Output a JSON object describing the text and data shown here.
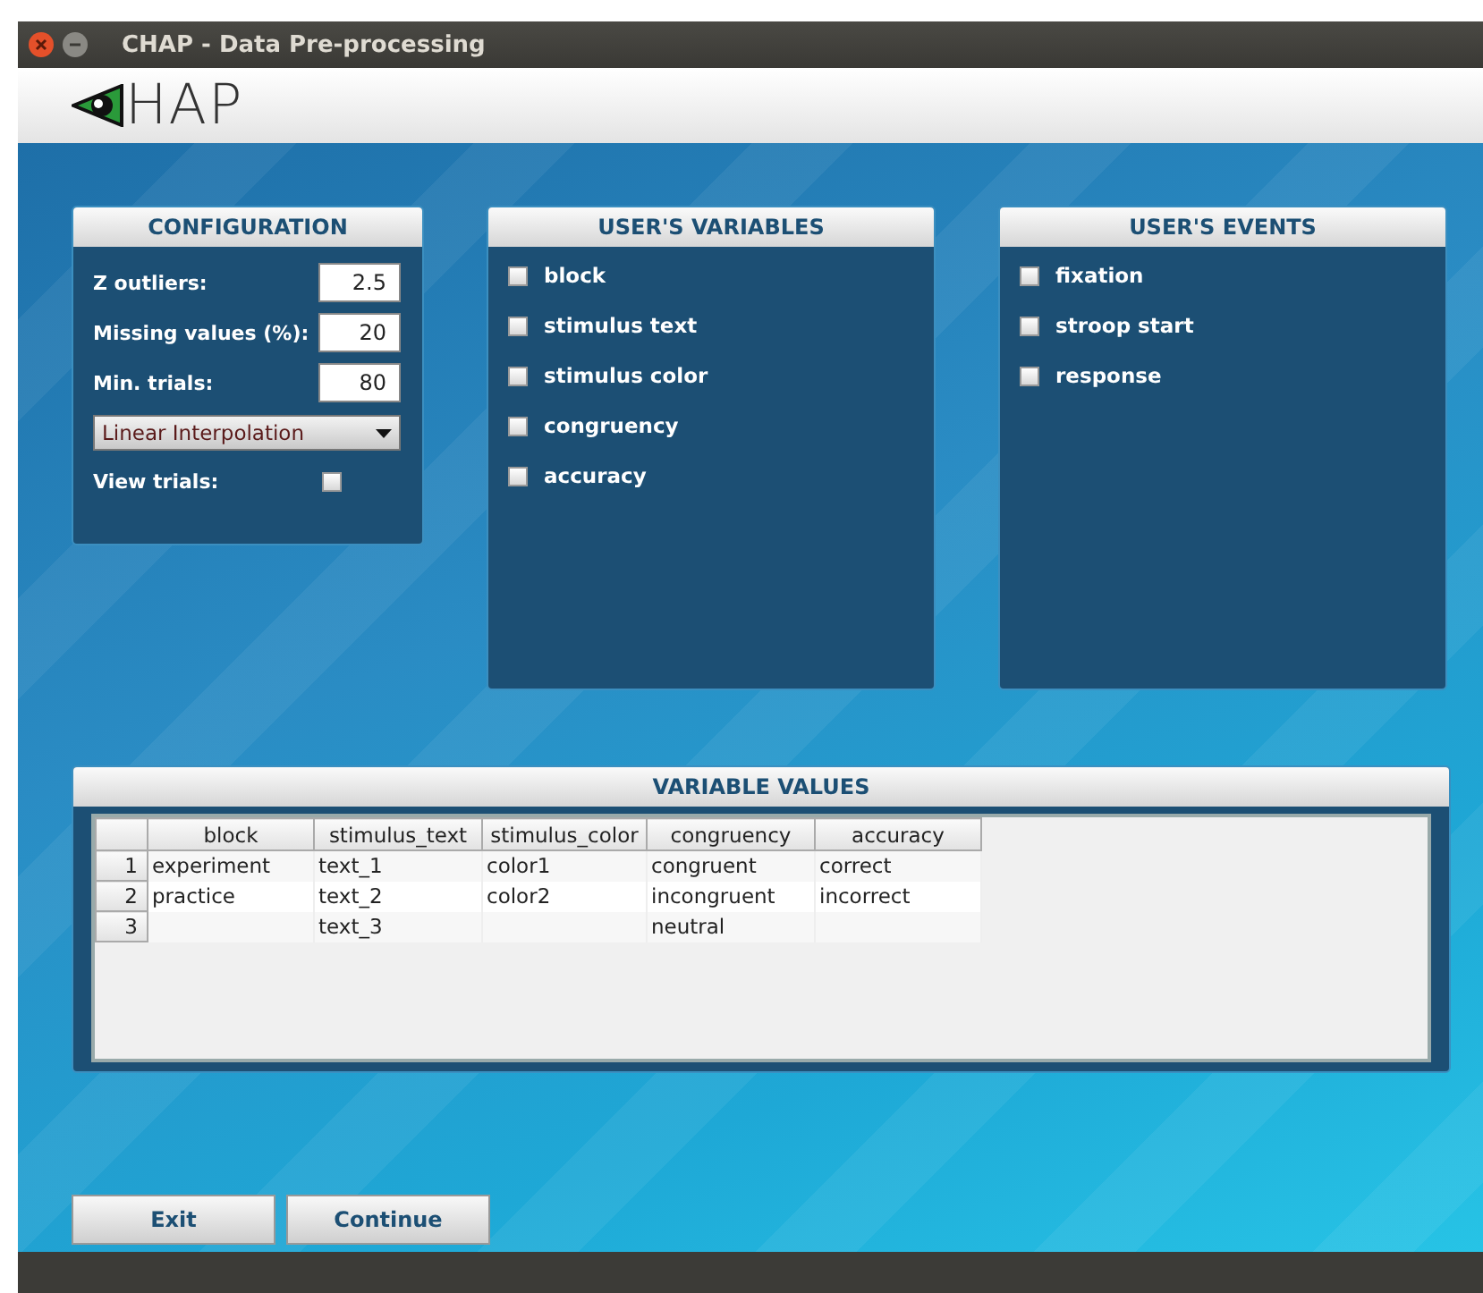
{
  "window": {
    "title": "CHAP - Data Pre-processing"
  },
  "logo": {
    "text": "HAP"
  },
  "configuration": {
    "title": "CONFIGURATION",
    "fields": [
      {
        "label": "Z outliers:",
        "value": "2.5"
      },
      {
        "label": "Missing values (%):",
        "value": "20"
      },
      {
        "label": "Min. trials:",
        "value": "80"
      }
    ],
    "method": {
      "value": "Linear Interpolation"
    },
    "view_trials": {
      "label": "View trials:",
      "checked": false
    }
  },
  "variables": {
    "title": "USER'S VARIABLES",
    "items": [
      {
        "label": "block",
        "checked": false
      },
      {
        "label": "stimulus text",
        "checked": false
      },
      {
        "label": "stimulus color",
        "checked": false
      },
      {
        "label": "congruency",
        "checked": false
      },
      {
        "label": "accuracy",
        "checked": false
      }
    ]
  },
  "events": {
    "title": "USER'S EVENTS",
    "items": [
      {
        "label": "fixation",
        "checked": false
      },
      {
        "label": "stroop start",
        "checked": false
      },
      {
        "label": "response",
        "checked": false
      }
    ]
  },
  "variable_values": {
    "title": "VARIABLE VALUES",
    "columns": [
      "block",
      "stimulus_text",
      "stimulus_color",
      "congruency",
      "accuracy"
    ],
    "rows": [
      {
        "number": "1",
        "cells": [
          "experiment",
          "text_1",
          "color1",
          "congruent",
          "correct"
        ]
      },
      {
        "number": "2",
        "cells": [
          "practice",
          "text_2",
          "color2",
          "incongruent",
          "incorrect"
        ]
      },
      {
        "number": "3",
        "cells": [
          null,
          "text_3",
          null,
          "neutral",
          null
        ]
      }
    ]
  },
  "buttons": [
    {
      "label": "Exit"
    },
    {
      "label": "Continue"
    }
  ]
}
